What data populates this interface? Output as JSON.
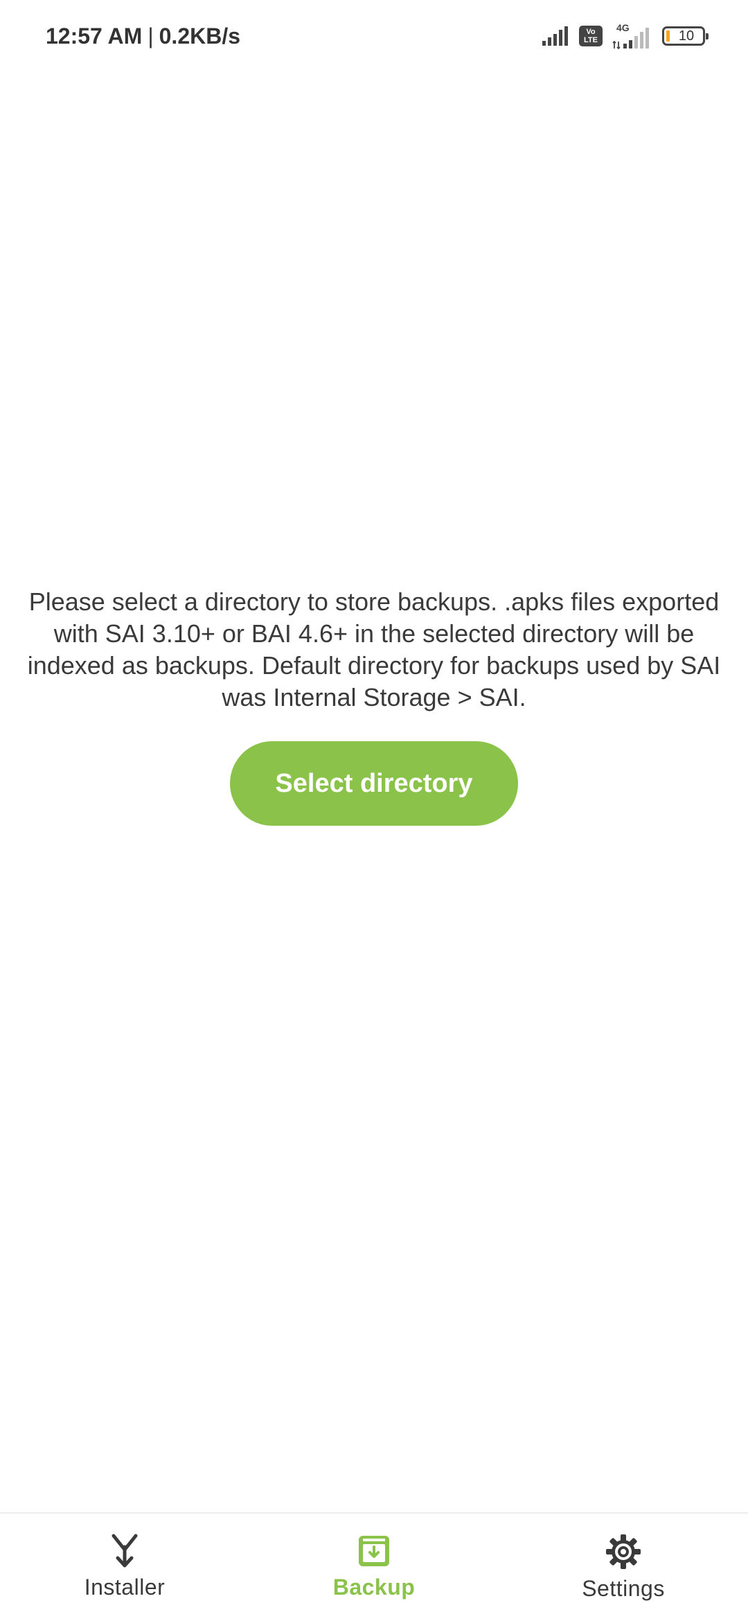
{
  "status_bar": {
    "time": "12:57 AM",
    "separator": "|",
    "net_speed": "0.2KB/s",
    "volte_line1": "Vo",
    "volte_line2": "LTE",
    "network_type": "4G",
    "battery_level": "10",
    "icons": [
      "signal-icon",
      "volte-icon",
      "signal-4g-icon",
      "battery-icon"
    ]
  },
  "main": {
    "message": "Please select a directory to store backups. .apks files exported with SAI 3.10+ or BAI 4.6+ in the selected directory will be indexed as backups. Default directory for backups used by SAI was Internal Storage > SAI.",
    "button_label": "Select directory"
  },
  "bottom_nav": {
    "items": [
      {
        "label": "Installer",
        "icon": "installer-merge-icon",
        "active": false
      },
      {
        "label": "Backup",
        "icon": "backup-archive-icon",
        "active": true
      },
      {
        "label": "Settings",
        "icon": "settings-gear-icon",
        "active": false
      }
    ]
  },
  "colors": {
    "accent": "#8bc34a",
    "text": "#3a3a3a",
    "background": "#ffffff",
    "battery_low": "#f5a623"
  }
}
